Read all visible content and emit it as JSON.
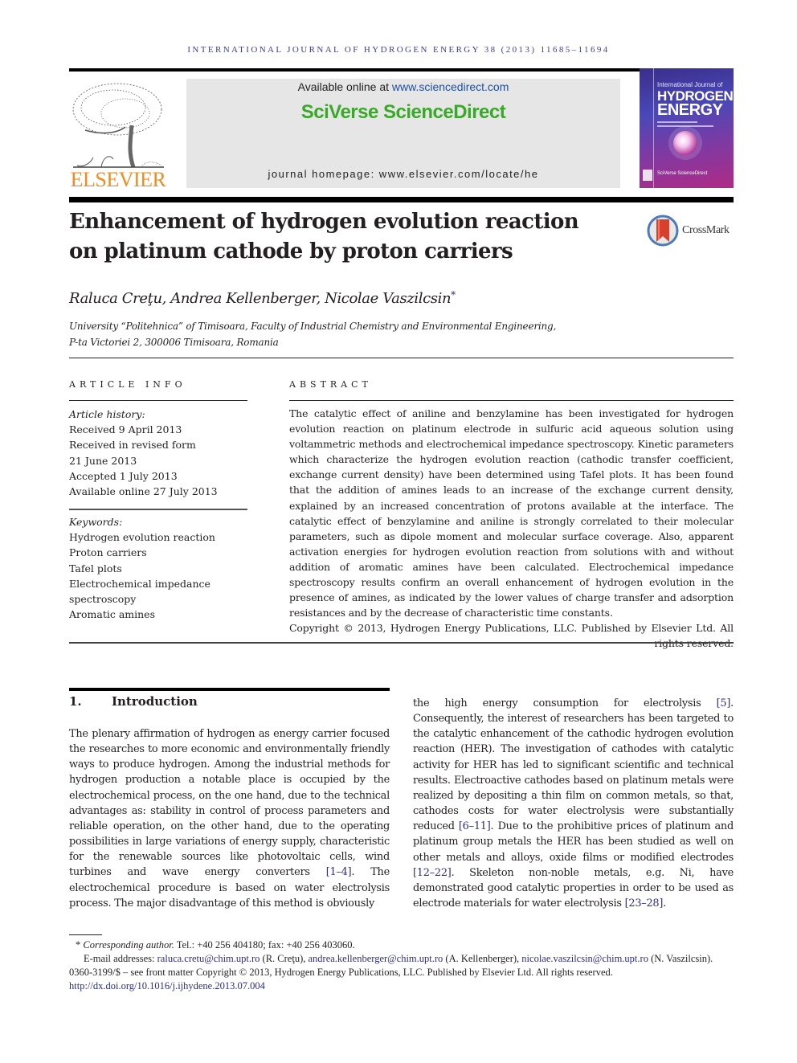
{
  "running_head": "INTERNATIONAL JOURNAL OF HYDROGEN ENERGY 38 (2013) 11685–11694",
  "publisher": {
    "logo_icon": "elsevier-tree-icon",
    "name": "ELSEVIER",
    "brand_color": "#f28c1c"
  },
  "sciencedirect": {
    "available_prefix": "Available online at ",
    "available_link": "www.sciencedirect.com",
    "brand": "SciVerse ScienceDirect",
    "brand_color": "#3aa829",
    "homepage": "journal homepage: www.elsevier.com/locate/he"
  },
  "journal_cover": {
    "line1": "International Journal of",
    "line2": "HYDROGEN",
    "line3": "ENERGY",
    "footer": "SciVerse ScienceDirect"
  },
  "article": {
    "title": "Enhancement of hydrogen evolution reaction on platinum cathode by proton carriers",
    "crossmark_label": "CrossMark",
    "authors": "Raluca Creţu, Andrea Kellenberger, Nicolae Vaszilcsin",
    "corresponding_mark": "*",
    "affiliation_line1": "University “Politehnica” of Timisoara, Faculty of Industrial Chemistry and Environmental Engineering,",
    "affiliation_line2": "P-ta Victoriei 2, 300006 Timisoara, Romania"
  },
  "article_info": {
    "heading": "ARTICLE INFO",
    "history_label": "Article history:",
    "history": [
      "Received 9 April 2013",
      "Received in revised form",
      "21 June 2013",
      "Accepted 1 July 2013",
      "Available online 27 July 2013"
    ],
    "keywords_label": "Keywords:",
    "keywords": [
      "Hydrogen evolution reaction",
      "Proton carriers",
      "Tafel plots",
      "Electrochemical impedance",
      "spectroscopy",
      "Aromatic amines"
    ]
  },
  "abstract": {
    "heading": "ABSTRACT",
    "text": "The catalytic effect of aniline and benzylamine has been investigated for hydrogen evolution reaction on platinum electrode in sulfuric acid aqueous solution using voltammetric methods and electrochemical impedance spectroscopy. Kinetic parameters which characterize the hydrogen evolution reaction (cathodic transfer coefficient, exchange current density) have been determined using Tafel plots. It has been found that the addition of amines leads to an increase of the exchange current density, explained by an increased concentration of protons available at the interface. The catalytic effect of benzylamine and aniline is strongly correlated to their molecular parameters, such as dipole moment and molecular surface coverage. Also, apparent activation energies for hydrogen evolution reaction from solutions with and without addition of aromatic amines have been calculated. Electrochemical impedance spectroscopy results confirm an overall enhancement of hydrogen evolution in the presence of amines, as indicated by the lower values of charge transfer and adsorption resistances and by the decrease of characteristic time constants.",
    "copyright": "Copyright © 2013, Hydrogen Energy Publications, LLC. Published by Elsevier Ltd. All rights reserved."
  },
  "introduction": {
    "number": "1.",
    "heading": "Introduction",
    "left_col": [
      {
        "t": "The plenary affirmation of hydrogen as energy carrier focused the researches to more economic and environmentally friendly ways to produce hydrogen. Among the industrial methods for hydrogen production a notable place is occupied by the electrochemical process, on the one hand, due to the technical advantages as: stability in control of process parameters and reliable operation, on the other hand, due to the operating possibilities in large variations of energy supply, characteristic for the renewable sources like photovoltaic cells, wind turbines and wave energy converters "
      },
      {
        "ref": "[1–4]"
      },
      {
        "t": ". The electrochemical procedure is based on water electrolysis process. The major disadvantage of this method is obviously"
      }
    ],
    "right_col": [
      {
        "t": "the high energy consumption for electrolysis "
      },
      {
        "ref": "[5]"
      },
      {
        "t": ". Consequently, the interest of researchers has been targeted to the catalytic enhancement of the cathodic hydrogen evolution reaction (HER). The investigation of cathodes with catalytic activity for HER has led to significant scientific and technical results. Electroactive cathodes based on platinum metals were realized by depositing a thin film on common metals, so that, cathodes costs for water electrolysis were substantially reduced "
      },
      {
        "ref": "[6–11]"
      },
      {
        "t": ". Due to the prohibitive prices of platinum and platinum group metals the HER has been studied as well on other metals and alloys, oxide films or modified electrodes "
      },
      {
        "ref": "[12–22]"
      },
      {
        "t": ". Skeleton non-noble metals, e.g. Ni, have demonstrated good catalytic properties in order to be used as electrode materials for water electrolysis "
      },
      {
        "ref": "[23–28]"
      },
      {
        "t": "."
      }
    ]
  },
  "footnotes": {
    "star": "*",
    "corresponding_label": "Corresponding author.",
    "contact": " Tel.: +40 256 404180; fax: +40 256 403060.",
    "email_label": "E-mail addresses: ",
    "emails": [
      {
        "address": "raluca.cretu@chim.upt.ro",
        "name": " (R. Creţu), "
      },
      {
        "address": "andrea.kellenberger@chim.upt.ro",
        "name": " (A. Kellenberger), "
      },
      {
        "address": "nicolae.vaszilcsin@chim.upt.ro",
        "name": " (N. Vaszilcsin)."
      }
    ],
    "issn_line": "0360-3199/$ – see front matter Copyright © 2013, Hydrogen Energy Publications, LLC. Published by Elsevier Ltd. All rights reserved.",
    "doi": "http://dx.doi.org/10.1016/j.ijhydene.2013.07.004"
  },
  "colors": {
    "link": "#2c2c8c",
    "text": "#231f20",
    "header_box": "#e6e6e6"
  }
}
